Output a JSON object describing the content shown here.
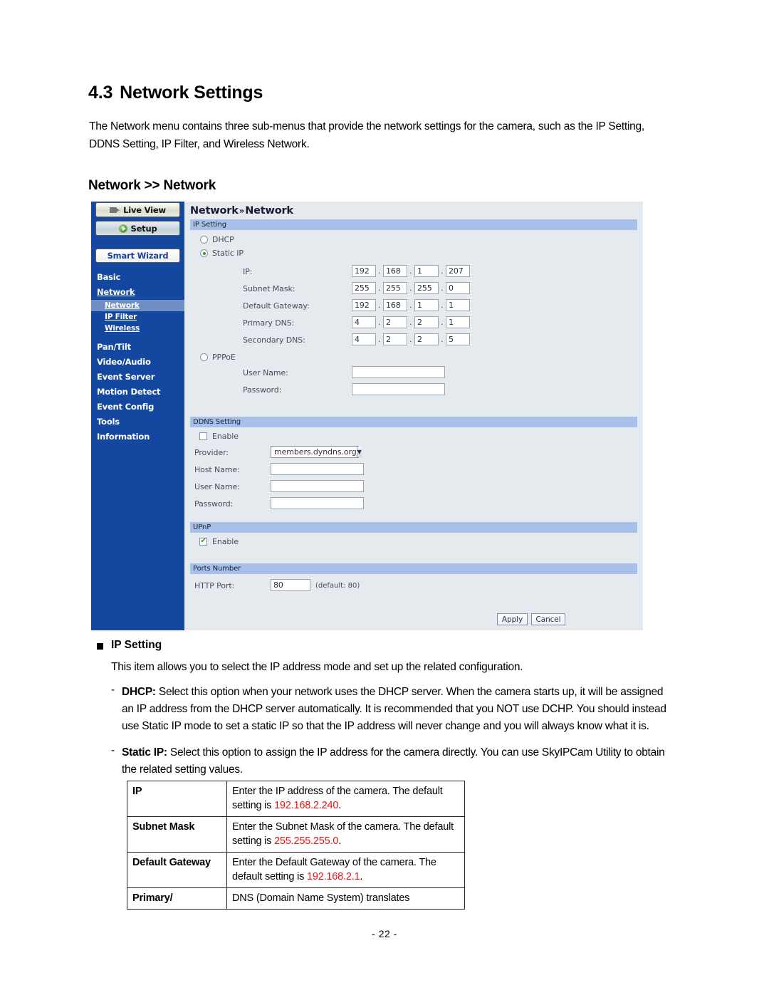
{
  "document": {
    "section_number": "4.3",
    "section_title": "Network Settings",
    "intro": "The Network menu contains three sub-menus that provide the network settings for the camera, such as the IP Setting, DDNS Setting, IP Filter, and Wireless Network.",
    "subheading": "Network >> Network",
    "page_number": "- 22 -"
  },
  "screenshot": {
    "sidebar": {
      "live_view": "Live View",
      "setup": "Setup",
      "smart_wizard": "Smart Wizard",
      "items": [
        {
          "label": "Basic",
          "type": "top"
        },
        {
          "label": "Network",
          "type": "top-underline"
        },
        {
          "label": "Network",
          "type": "sub",
          "selected": true
        },
        {
          "label": "IP Filter",
          "type": "sub",
          "selected": false
        },
        {
          "label": "Wireless",
          "type": "sub",
          "selected": false
        },
        {
          "label": "Pan/Tilt",
          "type": "top"
        },
        {
          "label": "Video/Audio",
          "type": "top"
        },
        {
          "label": "Event Server",
          "type": "top"
        },
        {
          "label": "Motion Detect",
          "type": "top"
        },
        {
          "label": "Event Config",
          "type": "top"
        },
        {
          "label": "Tools",
          "type": "top"
        },
        {
          "label": "Information",
          "type": "top"
        }
      ]
    },
    "panel": {
      "title_left": "Network",
      "title_chevron": "»",
      "title_right": "Network",
      "sections": {
        "ip_setting": "IP Setting",
        "ddns_setting": "DDNS Setting",
        "upnp": "UPnP",
        "ports_number": "Ports Number"
      },
      "ip_mode": {
        "dhcp_label": "DHCP",
        "dhcp_selected": false,
        "static_label": "Static IP",
        "static_selected": true,
        "pppoe_label": "PPPoE",
        "pppoe_selected": false
      },
      "rows": [
        {
          "label": "IP:",
          "octets": [
            "192",
            "168",
            "1",
            "207"
          ]
        },
        {
          "label": "Subnet Mask:",
          "octets": [
            "255",
            "255",
            "255",
            "0"
          ]
        },
        {
          "label": "Default Gateway:",
          "octets": [
            "192",
            "168",
            "1",
            "1"
          ]
        },
        {
          "label": "Primary DNS:",
          "octets": [
            "4",
            "2",
            "2",
            "1"
          ]
        },
        {
          "label": "Secondary DNS:",
          "octets": [
            "4",
            "2",
            "2",
            "5"
          ]
        }
      ],
      "pppoe": {
        "user_name_label": "User Name:",
        "user_name_value": "",
        "password_label": "Password:",
        "password_value": ""
      },
      "ddns": {
        "enable_label": "Enable",
        "enable_checked": false,
        "provider_label": "Provider:",
        "provider_value": "members.dyndns.org",
        "host_name_label": "Host Name:",
        "host_name_value": "",
        "user_name_label": "User Name:",
        "user_name_value": "",
        "password_label": "Password:",
        "password_value": ""
      },
      "upnp": {
        "enable_label": "Enable",
        "enable_checked": true
      },
      "ports": {
        "http_label": "HTTP Port:",
        "http_value": "80",
        "http_default_note": "(default: 80)"
      },
      "buttons": {
        "apply": "Apply",
        "cancel": "Cancel"
      }
    }
  },
  "body": {
    "bullet_heading": "IP Setting",
    "lead": "This item allows you to select the IP address mode and set up the related configuration.",
    "dash": "-",
    "dhcp_term": "DHCP:",
    "dhcp_text": " Select this option when your network uses the DHCP server. When the camera starts up, it will be assigned an IP address from the DHCP server automatically.  It is recommended that you NOT use DCHP.   You should instead use Static IP mode to set a static IP so that the IP address will never change and you will always know what it is.",
    "static_term": "Static IP:",
    "static_text": " Select this option to assign the IP address for the camera directly. You can use SkyIPCam Utility to obtain the related setting values."
  },
  "table": {
    "rows": [
      {
        "key": "IP",
        "pre": "Enter the IP address of the camera. The default setting is ",
        "red": "192.168.2.240",
        "post": "."
      },
      {
        "key": "Subnet Mask",
        "pre": "Enter the Subnet Mask of the camera. The default setting is ",
        "red": "255.255.255.0",
        "post": "."
      },
      {
        "key": "Default Gateway",
        "pre": "Enter the Default Gateway of the camera. The default setting is ",
        "red": "192.168.2.1",
        "post": "."
      },
      {
        "key": "Primary/",
        "pre": "DNS (Domain Name System) translates",
        "red": "",
        "post": ""
      }
    ]
  },
  "colors": {
    "sidebar_blue": "#14479f",
    "section_bar_blue": "#a6c0ea",
    "panel_bg": "#e5eaee",
    "selected_nav": "#6d8fc4",
    "red_value": "#ee1111"
  }
}
